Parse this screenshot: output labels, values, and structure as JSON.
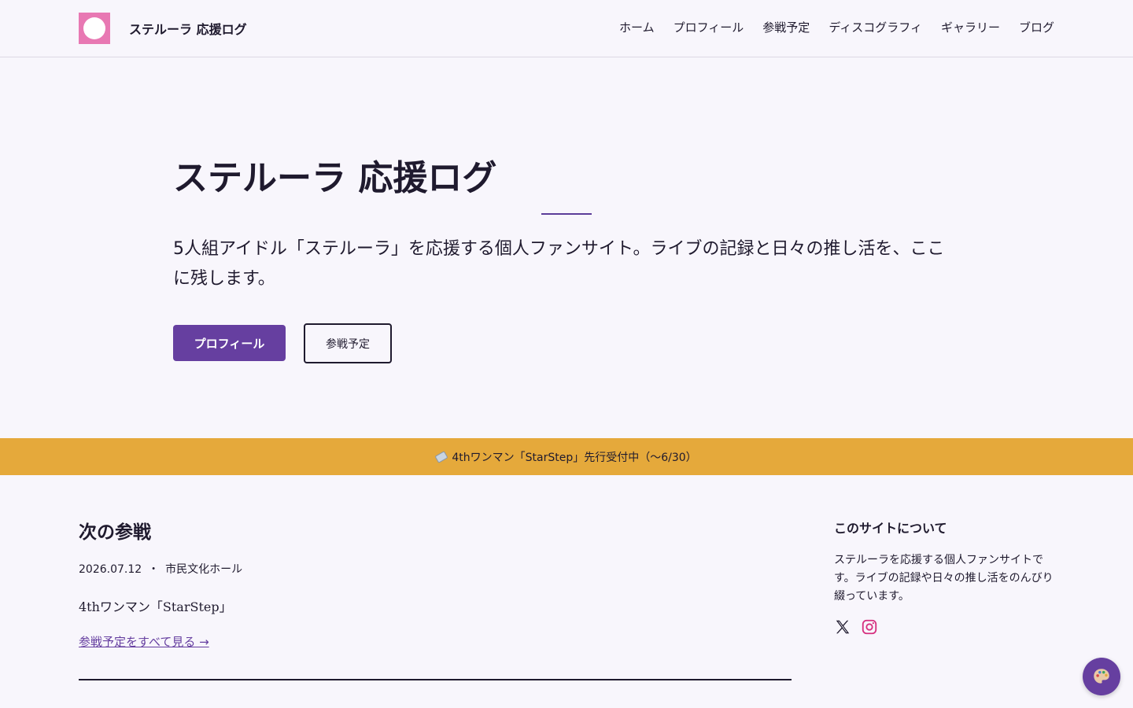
{
  "header": {
    "site_name": "ステルーラ 応援ログ",
    "nav": [
      "ホーム",
      "プロフィール",
      "参戦予定",
      "ディスコグラフィ",
      "ギャラリー",
      "ブログ"
    ]
  },
  "hero": {
    "title": "ステルーラ 応援ログ",
    "description": "5人組アイドル「ステルーラ」を応援する個人ファンサイト。ライブの記録と日々の推し活を、ここに残します。",
    "primary_button": "プロフィール",
    "secondary_button": "参戦予定"
  },
  "banner": {
    "icon": "ticket-icon",
    "text": "4thワンマン「StarStep」先行受付中（〜6/30）"
  },
  "next_event": {
    "heading": "次の参戦",
    "date": "2026.07.12",
    "separator": "・",
    "venue": "市民文化ホール",
    "name": "4thワンマン「StarStep」",
    "link": "参戦予定をすべて見る →"
  },
  "about": {
    "heading": "このサイトについて",
    "text": "ステルーラを応援する個人ファンサイトです。ライブの記録や日々の推し活をのんびり綴っています。",
    "social_icons": [
      "x-icon",
      "instagram-icon"
    ]
  },
  "fab": {
    "icon": "palette-icon"
  },
  "colors": {
    "accent": "#663fa0",
    "logo": "#e878b3",
    "banner": "#e5a93b",
    "background": "#f8f6fc",
    "instagram": "#d6307f"
  }
}
